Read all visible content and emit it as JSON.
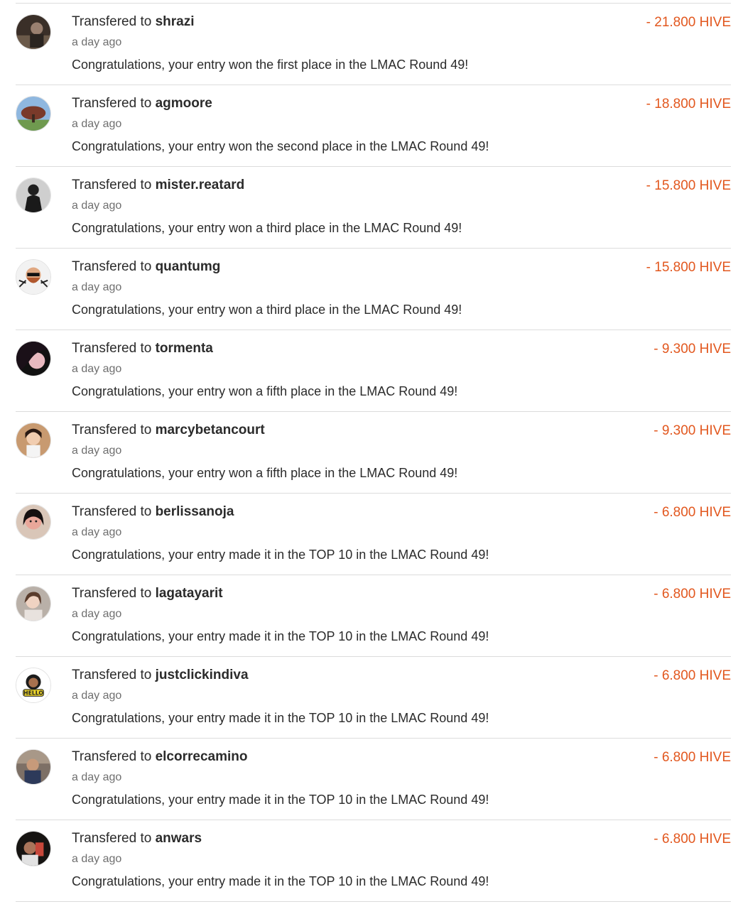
{
  "colors": {
    "amount": "#e2571e",
    "divider": "#dcdcdc",
    "text": "#2b2b2b",
    "muted": "#6f6f6f"
  },
  "transfers": [
    {
      "prefix": "Transfered to",
      "user": "shrazi",
      "time": "a day ago",
      "memo": "Congratulations, your entry won the first place in the LMAC Round 49!",
      "amount": "- 21.800 HIVE",
      "avatar": "avatar-photo"
    },
    {
      "prefix": "Transfered to",
      "user": "agmoore",
      "time": "a day ago",
      "memo": "Congratulations, your entry won the second place in the LMAC Round 49!",
      "amount": "- 18.800 HIVE",
      "avatar": "avatar-photo"
    },
    {
      "prefix": "Transfered to",
      "user": "mister.reatard",
      "time": "a day ago",
      "memo": "Congratulations, your entry won a third place in the LMAC Round 49!",
      "amount": "- 15.800 HIVE",
      "avatar": "avatar-photo"
    },
    {
      "prefix": "Transfered to",
      "user": "quantumg",
      "time": "a day ago",
      "memo": "Congratulations, your entry won a third place in the LMAC Round 49!",
      "amount": "- 15.800 HIVE",
      "avatar": "avatar-photo"
    },
    {
      "prefix": "Transfered to",
      "user": "tormenta",
      "time": "a day ago",
      "memo": "Congratulations, your entry won a fifth place in the LMAC Round 49!",
      "amount": "- 9.300 HIVE",
      "avatar": "avatar-photo"
    },
    {
      "prefix": "Transfered to",
      "user": "marcybetancourt",
      "time": "a day ago",
      "memo": "Congratulations, your entry won a fifth place in the LMAC Round 49!",
      "amount": "- 9.300 HIVE",
      "avatar": "avatar-photo"
    },
    {
      "prefix": "Transfered to",
      "user": "berlissanoja",
      "time": "a day ago",
      "memo": "Congratulations, your entry made it in the TOP 10 in the LMAC Round 49!",
      "amount": "- 6.800 HIVE",
      "avatar": "avatar-photo"
    },
    {
      "prefix": "Transfered to",
      "user": "lagatayarit",
      "time": "a day ago",
      "memo": "Congratulations, your entry made it in the TOP 10 in the LMAC Round 49!",
      "amount": "- 6.800 HIVE",
      "avatar": "avatar-photo"
    },
    {
      "prefix": "Transfered to",
      "user": "justclickindiva",
      "time": "a day ago",
      "memo": "Congratulations, your entry made it in the TOP 10 in the LMAC Round 49!",
      "amount": "- 6.800 HIVE",
      "avatar": "avatar-photo"
    },
    {
      "prefix": "Transfered to",
      "user": "elcorrecamino",
      "time": "a day ago",
      "memo": "Congratulations, your entry made it in the TOP 10 in the LMAC Round 49!",
      "amount": "- 6.800 HIVE",
      "avatar": "avatar-photo"
    },
    {
      "prefix": "Transfered to",
      "user": "anwars",
      "time": "a day ago",
      "memo": "Congratulations, your entry made it in the TOP 10 in the LMAC Round 49!",
      "amount": "- 6.800 HIVE",
      "avatar": "avatar-photo"
    }
  ]
}
